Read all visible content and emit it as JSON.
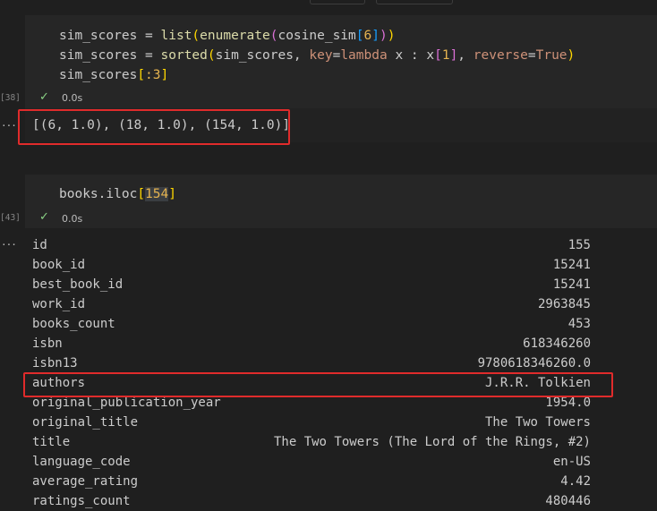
{
  "cell1": {
    "exec_count": "[38]",
    "status_time": "0.0s",
    "code_lines": [
      [
        {
          "t": "sim_scores ",
          "c": "plain"
        },
        {
          "t": "= ",
          "c": "plain"
        },
        {
          "t": "list",
          "c": "fn"
        },
        {
          "t": "(",
          "c": "br1"
        },
        {
          "t": "enumerate",
          "c": "fn"
        },
        {
          "t": "(",
          "c": "br2"
        },
        {
          "t": "cosine_sim",
          "c": "plain"
        },
        {
          "t": "[",
          "c": "br3"
        },
        {
          "t": "6",
          "c": "num"
        },
        {
          "t": "]",
          "c": "br3"
        },
        {
          "t": ")",
          "c": "br2"
        },
        {
          "t": ")",
          "c": "br1"
        }
      ],
      [
        {
          "t": "sim_scores ",
          "c": "plain"
        },
        {
          "t": "= ",
          "c": "plain"
        },
        {
          "t": "sorted",
          "c": "fn"
        },
        {
          "t": "(",
          "c": "br1"
        },
        {
          "t": "sim_scores, ",
          "c": "plain"
        },
        {
          "t": "key",
          "c": "kw"
        },
        {
          "t": "=",
          "c": "plain"
        },
        {
          "t": "lambda ",
          "c": "kw"
        },
        {
          "t": "x : x",
          "c": "plain"
        },
        {
          "t": "[",
          "c": "br2"
        },
        {
          "t": "1",
          "c": "num"
        },
        {
          "t": "]",
          "c": "br2"
        },
        {
          "t": ", ",
          "c": "plain"
        },
        {
          "t": "reverse",
          "c": "kw"
        },
        {
          "t": "=",
          "c": "plain"
        },
        {
          "t": "True",
          "c": "kw"
        },
        {
          "t": ")",
          "c": "br1"
        }
      ],
      [
        {
          "t": "sim_scores",
          "c": "plain"
        },
        {
          "t": "[",
          "c": "br1"
        },
        {
          "t": ":3",
          "c": "num"
        },
        {
          "t": "]",
          "c": "br1"
        }
      ]
    ],
    "output": "[(6, 1.0), (18, 1.0), (154, 1.0)]"
  },
  "cell2": {
    "exec_count": "[43]",
    "status_time": "0.0s",
    "code_lines": [
      [
        {
          "t": "books.iloc",
          "c": "plain"
        },
        {
          "t": "[",
          "c": "br1"
        },
        {
          "t": "154",
          "c": "numsel"
        },
        {
          "t": "]",
          "c": "br1"
        }
      ]
    ],
    "output_rows": [
      {
        "key": "id",
        "value": "155"
      },
      {
        "key": "book_id",
        "value": "15241"
      },
      {
        "key": "best_book_id",
        "value": "15241"
      },
      {
        "key": "work_id",
        "value": "2963845"
      },
      {
        "key": "books_count",
        "value": "453"
      },
      {
        "key": "isbn",
        "value": "618346260"
      },
      {
        "key": "isbn13",
        "value": "9780618346260.0"
      },
      {
        "key": "authors",
        "value": "J.R.R. Tolkien"
      },
      {
        "key": "original_publication_year",
        "value": "1954.0"
      },
      {
        "key": "original_title",
        "value": "The Two Towers"
      },
      {
        "key": "title",
        "value": "The Two Towers (The Lord of the Rings, #2)"
      },
      {
        "key": "language_code",
        "value": "en-US"
      },
      {
        "key": "average_rating",
        "value": "4.42"
      },
      {
        "key": "ratings_count",
        "value": "480446"
      }
    ]
  },
  "ellipsis": "...",
  "check_icon": "✓",
  "colors": {
    "highlight_box": "#e02b2b",
    "cell_bg": "#262626",
    "page_bg": "#1f1f1f",
    "success": "#89d185"
  }
}
